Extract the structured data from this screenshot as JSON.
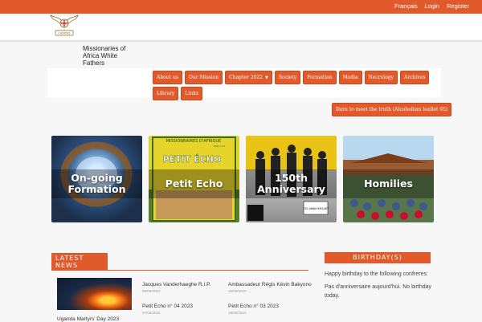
{
  "topbar": {
    "links": [
      "Français",
      "Login",
      "Register"
    ]
  },
  "site": {
    "name": "Missionaries of Africa White Fathers",
    "logo_banner": "CARITAS"
  },
  "nav": {
    "items": [
      {
        "label": "About us"
      },
      {
        "label": "Our Mission"
      },
      {
        "label": "Chapter 2022",
        "has_dropdown": true
      },
      {
        "label": "Society"
      },
      {
        "label": "Formation"
      },
      {
        "label": "Media"
      },
      {
        "label": "Necrology"
      },
      {
        "label": "Archives"
      },
      {
        "label": "Library"
      },
      {
        "label": "Links"
      },
      {
        "label": "Dare to meet the truth (Alcoholism leaflet 05)"
      }
    ]
  },
  "tiles": [
    {
      "label": "On-going Formation",
      "image": "hands-around-globe"
    },
    {
      "label": "Petit Echo",
      "image": "petit-echo-cover"
    },
    {
      "label": "150th Anniversary",
      "image": "historic-photo"
    },
    {
      "label": "Homilies",
      "image": "outdoor-mass"
    }
  ],
  "petit_echo_cover": {
    "top": "MISSIONNAIRES D'AFRIQUE",
    "sub": "2017 | 01",
    "title": "PETIT ÉCHO"
  },
  "anniv_sign": "150 ANNIVERSARY",
  "latest_news": {
    "heading": "LATEST NEWS",
    "feature_caption": "Uganda Martyrs' Day 2023",
    "items": [
      {
        "title": "Jacques Vanderhaeghe R.I.P.",
        "date": "09/06/2023"
      },
      {
        "title": "Ambassadeur Régis Kévin Bakyono",
        "date": "15/05/2023"
      },
      {
        "title": "Petit Echo n° 04 2023",
        "date": "07/06/2023"
      },
      {
        "title": "Petit Echo n° 03 2023",
        "date": "18/05/2023"
      }
    ]
  },
  "birthday": {
    "heading": "BIRTHDAY(S)",
    "intro": "Happy birthday to the following confreres:",
    "text": "Pas d'anniversaire aujourd'hui. No birthday today."
  },
  "colors": {
    "accent": "#e05a2b",
    "background": "#f7f7f7"
  }
}
